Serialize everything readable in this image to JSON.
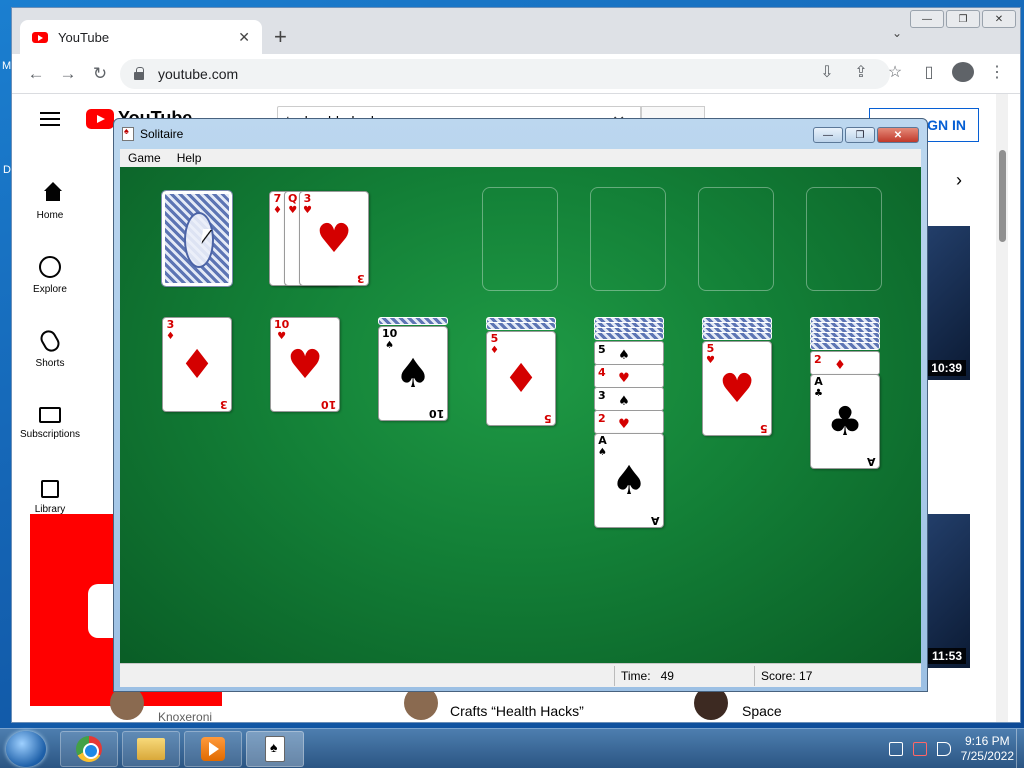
{
  "desktop": {
    "frag_m": "M",
    "frag_d": "D"
  },
  "chrome": {
    "window_controls": [
      "—",
      "❐",
      "✕"
    ],
    "tab": {
      "title": "YouTube",
      "close": "✕"
    },
    "new_tab": "+",
    "tab_dropdown": "⌄",
    "nav": {
      "back": "←",
      "forward": "→",
      "reload": "↻"
    },
    "url": "youtube.com",
    "tools": [
      "⇩",
      "⇪",
      "☆",
      "▯",
      "⋮"
    ]
  },
  "youtube": {
    "logo_text": "YouTube",
    "search_value": "technoblade dog",
    "search_clear": "✕",
    "signin": "SIGN IN",
    "chips_next": "›",
    "sidebar": [
      {
        "label": "Home",
        "icon": "home-icon"
      },
      {
        "label": "Explore",
        "icon": "compass-icon"
      },
      {
        "label": "Shorts",
        "icon": "shorts-icon"
      },
      {
        "label": "Subscriptions",
        "icon": "subscriptions-icon"
      },
      {
        "label": "Library",
        "icon": "library-icon"
      }
    ],
    "durations": [
      "10:39",
      "11:53"
    ],
    "bottom": {
      "channel1": "Knoxeroni",
      "title2": "Crafts “Health Hacks”",
      "title3": "Space"
    }
  },
  "solitaire": {
    "title": "Solitaire",
    "controls": [
      "—",
      "❐",
      "✕"
    ],
    "menu": [
      "Game",
      "Help"
    ],
    "status": {
      "time_label": "Time:",
      "time_value": "49",
      "score_label": "Score:",
      "score_value": "17"
    },
    "waste": [
      {
        "rank": "7",
        "suit": "♦",
        "color": "red"
      },
      {
        "rank": "Q",
        "suit": "♥",
        "color": "red"
      },
      {
        "rank": "3",
        "suit": "♥",
        "color": "red"
      }
    ],
    "tableau": [
      {
        "top": {
          "rank": "3",
          "suit": "♦",
          "color": "red"
        }
      },
      {
        "top": {
          "rank": "10",
          "suit": "♥",
          "color": "red"
        }
      },
      {
        "top": {
          "rank": "10",
          "suit": "♠",
          "color": "blk"
        }
      },
      {
        "top": {
          "rank": "5",
          "suit": "♦",
          "color": "red"
        }
      },
      {
        "run": [
          {
            "rank": "5",
            "suit": "♠",
            "color": "blk"
          },
          {
            "rank": "4",
            "suit": "♥",
            "color": "red"
          },
          {
            "rank": "3",
            "suit": "♠",
            "color": "blk"
          },
          {
            "rank": "2",
            "suit": "♥",
            "color": "red"
          }
        ],
        "top": {
          "rank": "A",
          "suit": "♠",
          "color": "blk"
        }
      },
      {
        "top": {
          "rank": "5",
          "suit": "♥",
          "color": "red"
        }
      },
      {
        "run": [
          {
            "rank": "2",
            "suit": "♦",
            "color": "red"
          }
        ],
        "top": {
          "rank": "A",
          "suit": "♣",
          "color": "blk"
        }
      }
    ]
  },
  "taskbar": {
    "apps": [
      "chrome-icon",
      "folder-icon",
      "media-player-icon",
      "solitaire-icon"
    ],
    "clock_time": "9:16 PM",
    "clock_date": "7/25/2022"
  }
}
